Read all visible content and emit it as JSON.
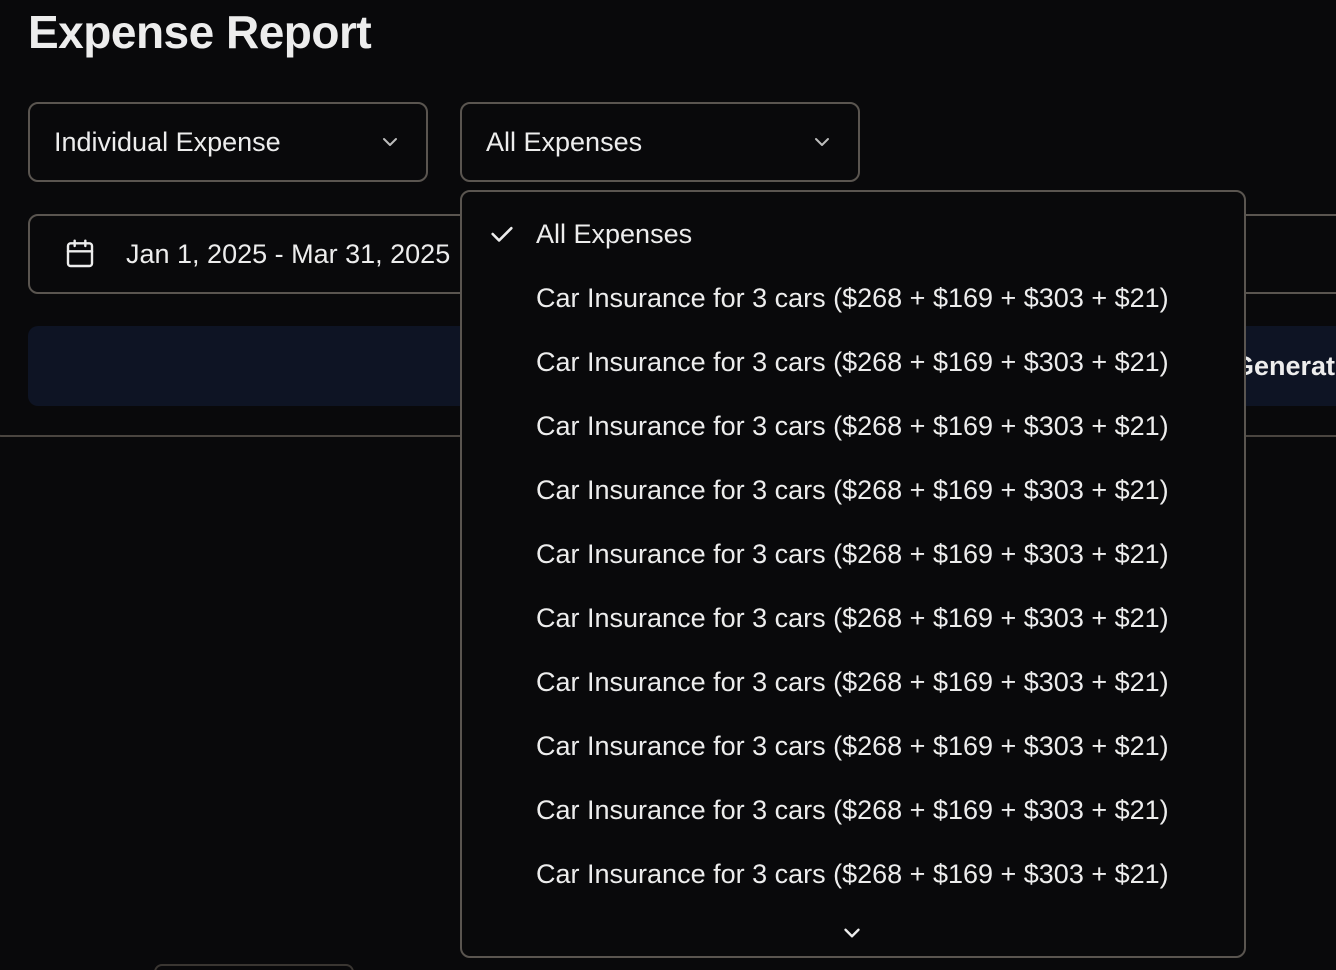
{
  "page": {
    "title": "Expense Report"
  },
  "filters": {
    "type_select": {
      "value": "Individual Expense"
    },
    "expense_select": {
      "value": "All Expenses"
    },
    "date_range": {
      "value": "Jan 1, 2025 - Mar 31, 2025"
    },
    "generate_button": {
      "label": "Generate Report"
    }
  },
  "dropdown": {
    "options": [
      {
        "label": "All Expenses",
        "selected": true
      },
      {
        "label": "Car Insurance for 3 cars ($268 + $169 + $303 + $21)",
        "selected": false
      },
      {
        "label": "Car Insurance for 3 cars ($268 + $169 + $303 + $21)",
        "selected": false
      },
      {
        "label": "Car Insurance for 3 cars ($268 + $169 + $303 + $21)",
        "selected": false
      },
      {
        "label": "Car Insurance for 3 cars ($268 + $169 + $303 + $21)",
        "selected": false
      },
      {
        "label": "Car Insurance for 3 cars ($268 + $169 + $303 + $21)",
        "selected": false
      },
      {
        "label": "Car Insurance for 3 cars ($268 + $169 + $303 + $21)",
        "selected": false
      },
      {
        "label": "Car Insurance for 3 cars ($268 + $169 + $303 + $21)",
        "selected": false
      },
      {
        "label": "Car Insurance for 3 cars ($268 + $169 + $303 + $21)",
        "selected": false
      },
      {
        "label": "Car Insurance for 3 cars ($268 + $169 + $303 + $21)",
        "selected": false
      },
      {
        "label": "Car Insurance for 3 cars ($268 + $169 + $303 + $21)",
        "selected": false
      }
    ],
    "icons": {
      "selected": "check-icon",
      "scroll": "chevron-down-icon"
    }
  },
  "colors": {
    "background": "#09090b",
    "text": "#ededed",
    "border": "#5a5550",
    "button_bg": "#0e1424"
  }
}
